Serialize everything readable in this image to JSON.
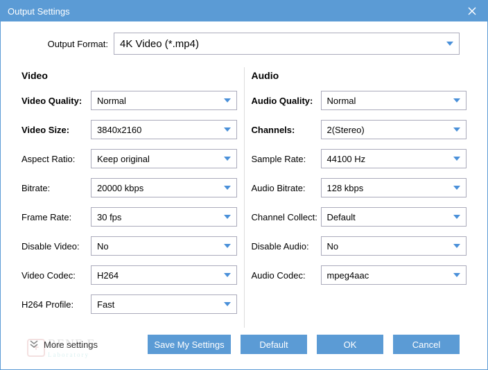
{
  "title": "Output Settings",
  "format": {
    "label": "Output Format:",
    "value": "4K Video (*.mp4)"
  },
  "video": {
    "heading": "Video",
    "quality": {
      "label": "Video Quality:",
      "value": "Normal"
    },
    "size": {
      "label": "Video Size:",
      "value": "3840x2160"
    },
    "aspect": {
      "label": "Aspect Ratio:",
      "value": "Keep original"
    },
    "bitrate": {
      "label": "Bitrate:",
      "value": "20000 kbps"
    },
    "framerate": {
      "label": "Frame Rate:",
      "value": "30 fps"
    },
    "disable": {
      "label": "Disable Video:",
      "value": "No"
    },
    "codec": {
      "label": "Video Codec:",
      "value": "H264"
    },
    "profile": {
      "label": "H264 Profile:",
      "value": "Fast"
    }
  },
  "audio": {
    "heading": "Audio",
    "quality": {
      "label": "Audio Quality:",
      "value": "Normal"
    },
    "channels": {
      "label": "Channels:",
      "value": "2(Stereo)"
    },
    "samplerate": {
      "label": "Sample Rate:",
      "value": "44100 Hz"
    },
    "bitrate": {
      "label": "Audio Bitrate:",
      "value": "128 kbps"
    },
    "collect": {
      "label": "Channel Collect:",
      "value": "Default"
    },
    "disable": {
      "label": "Disable Audio:",
      "value": "No"
    },
    "codec": {
      "label": "Audio Codec:",
      "value": "mpeg4aac"
    }
  },
  "more": "More settings",
  "buttons": {
    "save": "Save My Settings",
    "default": "Default",
    "ok": "OK",
    "cancel": "Cancel"
  },
  "watermark": {
    "badge": "+",
    "line1": "RENE.E",
    "line2": "Laboratory"
  }
}
